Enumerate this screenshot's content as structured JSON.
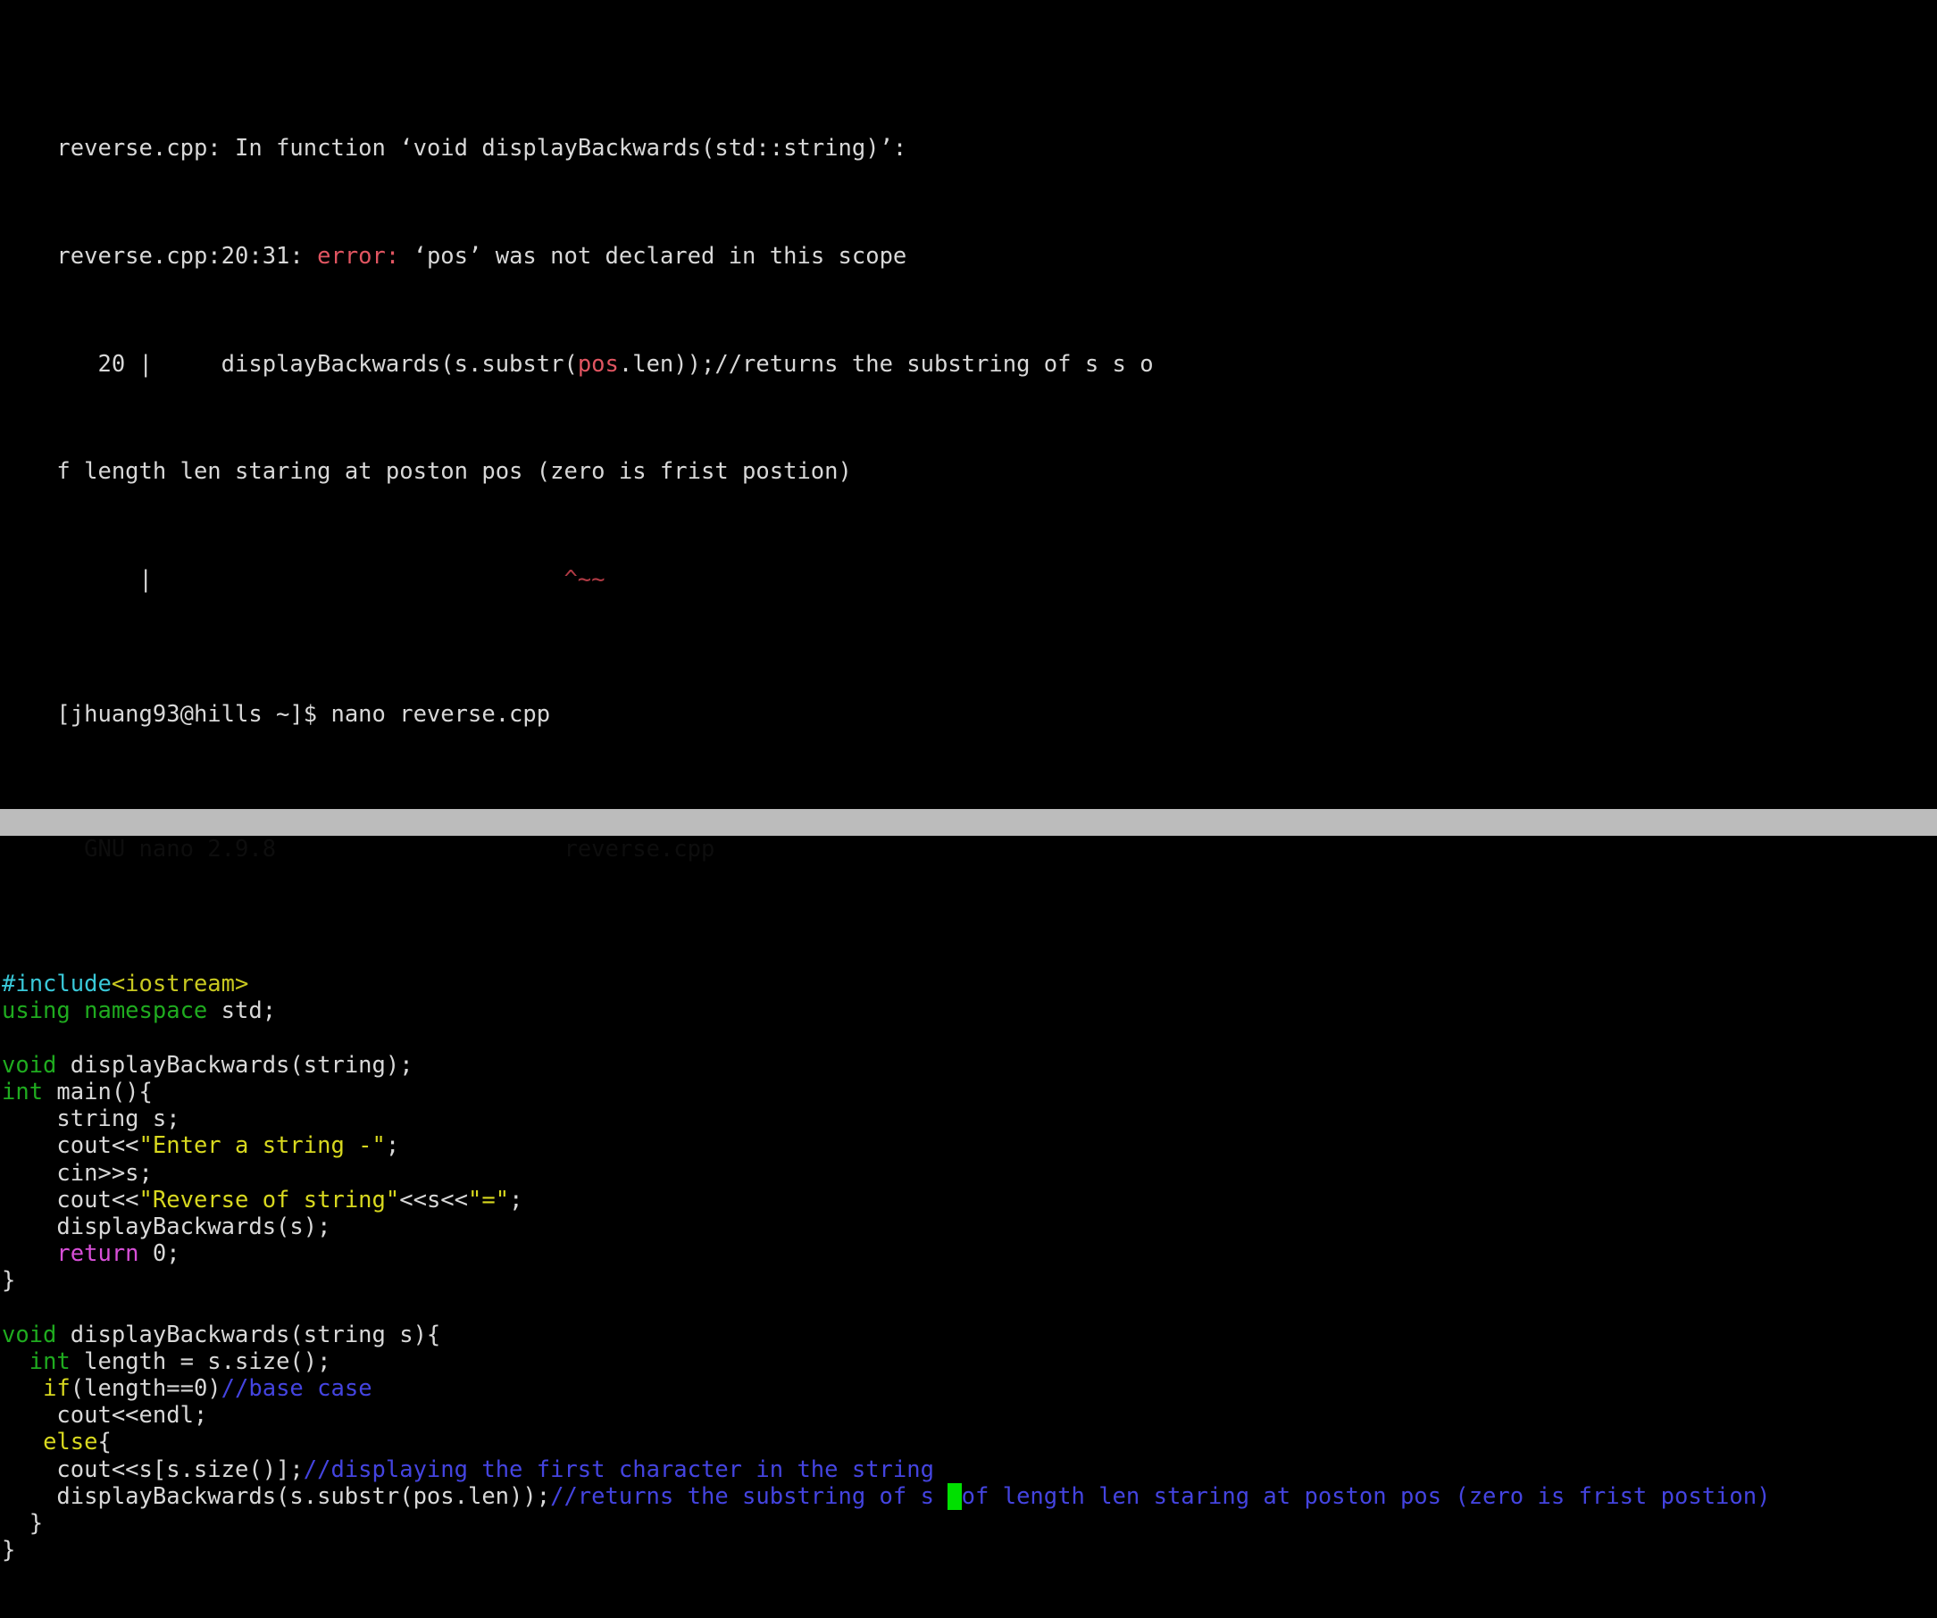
{
  "terminal": {
    "background_color": "#000000",
    "default_fg": "#d8d8d8",
    "cursor_color": "#00e000"
  },
  "compiler_output": {
    "line1": {
      "file": "reverse.cpp:",
      "text": " In function ",
      "signature": "‘void displayBackwards(std::string)’:"
    },
    "line2": {
      "location": "reverse.cpp:20:31: ",
      "severity": "error:",
      "message": " ‘pos’ was not declared in this scope"
    },
    "line3": {
      "lineno": "   20 |",
      "code_a": "     displayBackwards(s.substr(",
      "code_highlight": "pos",
      "code_b": ".len));",
      "comment": "//returns the substring of s s o"
    },
    "line4": {
      "wrapped": "f length len staring at poston pos (zero is frist postion)"
    },
    "line5": {
      "gutter": "      |",
      "caret": "                              ^~~"
    }
  },
  "shell": {
    "prompt": "[jhuang93@hills ~]$ ",
    "command": "nano reverse.cpp"
  },
  "nano": {
    "title_left": "  GNU nano 2.9.8",
    "title_center": "reverse.cpp",
    "titlebar_bg": "#bcbcbc",
    "titlebar_fg": "#0d0d0d"
  },
  "code": {
    "lines": [
      {
        "id": "blank-1",
        "segments": []
      },
      {
        "id": "include",
        "segments": [
          {
            "t": "#include",
            "c": "fg-cyan"
          },
          {
            "t": "<iostream>",
            "c": "fg-olive"
          }
        ]
      },
      {
        "id": "using-namespace",
        "segments": [
          {
            "t": "using namespace",
            "c": "fg-green"
          },
          {
            "t": " std;",
            "c": "fg-default"
          }
        ]
      },
      {
        "id": "blank-2",
        "segments": []
      },
      {
        "id": "proto-displaybackwards",
        "segments": [
          {
            "t": "void",
            "c": "fg-green"
          },
          {
            "t": " displayBackwards(string);",
            "c": "fg-default"
          }
        ]
      },
      {
        "id": "main-decl",
        "segments": [
          {
            "t": "int",
            "c": "fg-green"
          },
          {
            "t": " main(){",
            "c": "fg-default"
          }
        ]
      },
      {
        "id": "decl-string-s",
        "segments": [
          {
            "t": "    string s;",
            "c": "fg-default"
          }
        ]
      },
      {
        "id": "cout-enter-string",
        "segments": [
          {
            "t": "    cout<<",
            "c": "fg-default"
          },
          {
            "t": "\"Enter a string -\"",
            "c": "fg-yellow"
          },
          {
            "t": ";",
            "c": "fg-default"
          }
        ]
      },
      {
        "id": "cin-s",
        "segments": [
          {
            "t": "    cin>>s;",
            "c": "fg-default"
          }
        ]
      },
      {
        "id": "cout-reverse-of-string",
        "segments": [
          {
            "t": "    cout<<",
            "c": "fg-default"
          },
          {
            "t": "\"Reverse of string\"",
            "c": "fg-yellow"
          },
          {
            "t": "<<s<<",
            "c": "fg-default"
          },
          {
            "t": "\"=\"",
            "c": "fg-yellow"
          },
          {
            "t": ";",
            "c": "fg-default"
          }
        ]
      },
      {
        "id": "call-displaybackwards",
        "segments": [
          {
            "t": "    displayBackwards(s);",
            "c": "fg-default"
          }
        ]
      },
      {
        "id": "return-zero",
        "segments": [
          {
            "t": "    ",
            "c": "fg-default"
          },
          {
            "t": "return",
            "c": "fg-magenta"
          },
          {
            "t": " 0;",
            "c": "fg-default"
          }
        ]
      },
      {
        "id": "close-main",
        "segments": [
          {
            "t": "}",
            "c": "fg-default"
          }
        ]
      },
      {
        "id": "blank-3",
        "segments": []
      },
      {
        "id": "def-displaybackwards",
        "segments": [
          {
            "t": "void",
            "c": "fg-green"
          },
          {
            "t": " displayBackwards(string s){",
            "c": "fg-default"
          }
        ]
      },
      {
        "id": "int-length",
        "segments": [
          {
            "t": "  ",
            "c": "fg-default"
          },
          {
            "t": "int",
            "c": "fg-green"
          },
          {
            "t": " length = s.size();",
            "c": "fg-default"
          }
        ]
      },
      {
        "id": "if-base-case",
        "segments": [
          {
            "t": "   ",
            "c": "fg-default"
          },
          {
            "t": "if",
            "c": "fg-yellow"
          },
          {
            "t": "(length==0)",
            "c": "fg-default"
          },
          {
            "t": "//base case",
            "c": "fg-blue"
          }
        ]
      },
      {
        "id": "cout-endl",
        "segments": [
          {
            "t": "    cout<<endl;",
            "c": "fg-default"
          }
        ]
      },
      {
        "id": "else-open",
        "segments": [
          {
            "t": "   ",
            "c": "fg-default"
          },
          {
            "t": "else",
            "c": "fg-yellow"
          },
          {
            "t": "{",
            "c": "fg-default"
          }
        ]
      },
      {
        "id": "cout-first-char",
        "segments": [
          {
            "t": "    cout<<s[s.size()];",
            "c": "fg-default"
          },
          {
            "t": "//displaying the first character in the string",
            "c": "fg-blue"
          }
        ]
      },
      {
        "id": "recursive-call",
        "segments": [
          {
            "t": "    displayBackwards(s.substr(pos.len));",
            "c": "fg-default"
          },
          {
            "t": "//returns the substring of s ",
            "c": "fg-blue"
          },
          {
            "t": " ",
            "c": "cursor-block"
          },
          {
            "t": "of length len staring at poston pos (zero is frist postion)",
            "c": "fg-blue"
          }
        ]
      },
      {
        "id": "close-else",
        "segments": [
          {
            "t": "  }",
            "c": "fg-default"
          }
        ]
      },
      {
        "id": "close-function",
        "segments": [
          {
            "t": "}",
            "c": "fg-default"
          }
        ]
      }
    ]
  }
}
